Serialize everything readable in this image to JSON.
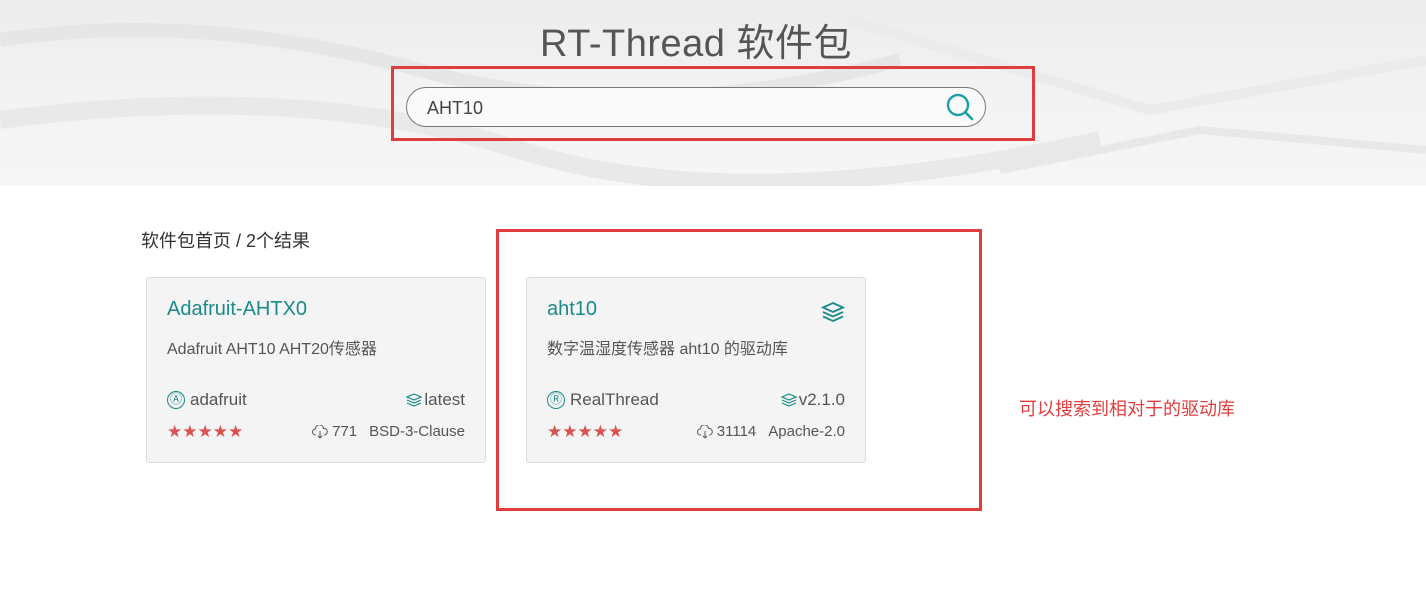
{
  "header": {
    "title": "RT-Thread 软件包",
    "search": {
      "value": "AHT10",
      "placeholder": ""
    }
  },
  "breadcrumb": {
    "home": "软件包首页",
    "separator": " / ",
    "result_count": "2个结果"
  },
  "packages": [
    {
      "name": "Adafruit-AHTX0",
      "description": "Adafruit AHT10 AHT20传感器",
      "author_icon": "Ⓐ",
      "author": "adafruit",
      "version": "latest",
      "rating": "★★★★★",
      "downloads": "771",
      "license": "BSD-3-Clause",
      "has_badge": false
    },
    {
      "name": "aht10",
      "description": "数字温湿度传感器 aht10 的驱动库",
      "author_icon": "Ⓡ",
      "author": "RealThread",
      "version": "v2.1.0",
      "rating": "★★★★★",
      "downloads": "31114",
      "license": "Apache-2.0",
      "has_badge": true
    }
  ],
  "annotation": {
    "note": "可以搜索到相对于的驱动库"
  },
  "colors": {
    "accent": "#1a8a8a",
    "annotation": "#e03e3e",
    "star": "#d9534f"
  }
}
